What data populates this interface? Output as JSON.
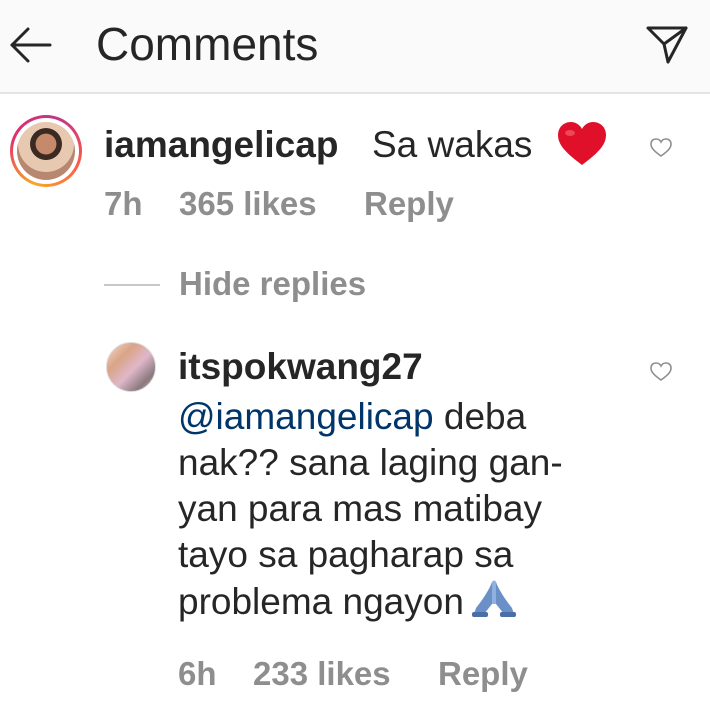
{
  "header": {
    "title": "Comments"
  },
  "comment": {
    "username": "iamangelicap",
    "text": "Sa wakas",
    "time": "7h",
    "likes": "365 likes",
    "reply_label": "Reply"
  },
  "replies_toggle": "Hide replies",
  "reply": {
    "username": "itspokwang27",
    "mention": "@iamangelicap",
    "line1_rest": " deba",
    "lines": [
      "nak?? sana laging gan-",
      "yan para mas matibay",
      "tayo sa pagharap sa",
      "problema ngayon"
    ],
    "time": "6h",
    "likes": "233 likes",
    "reply_label": "Reply"
  },
  "colors": {
    "text": "#262626",
    "muted": "#8e8e8e",
    "mention": "#003569",
    "heart_red": "#e0102a"
  },
  "icons": {
    "back": "arrow-left-icon",
    "share": "paper-plane-icon",
    "heart_emoji": "red-heart-emoji",
    "like": "heart-outline-icon",
    "pray_emoji": "folded-hands-emoji"
  }
}
